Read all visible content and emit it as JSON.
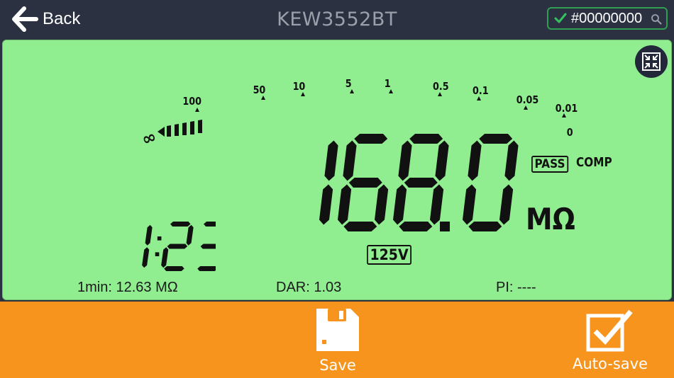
{
  "header": {
    "back_label": "Back",
    "title": "KEW3552BT",
    "device_id": "#00000000"
  },
  "lcd": {
    "scale_labels": [
      "100",
      "50",
      "10",
      "5",
      "1",
      "0.5",
      "0.1",
      "0.05",
      "0.01",
      "0"
    ],
    "infinity_symbol": "∞",
    "main_value": "168.0",
    "unit": "MΩ",
    "pass_label": "PASS",
    "comp_label": "COMP",
    "timer": "1:23",
    "voltage": "125V",
    "readouts": {
      "one_min": "1min: 12.63 MΩ",
      "dar": "DAR:  1.03",
      "pi": "PI: ----"
    }
  },
  "footer": {
    "save_label": "Save",
    "autosave_label": "Auto-save"
  },
  "colors": {
    "header_bg": "#2b3140",
    "lcd_bg": "#90ee90",
    "footer_bg": "#f7941d",
    "connected_green": "#2f9e52"
  },
  "icons": [
    "back-arrow-icon",
    "check-icon",
    "search-icon",
    "shrink-icon",
    "save-icon",
    "autosave-icon"
  ]
}
